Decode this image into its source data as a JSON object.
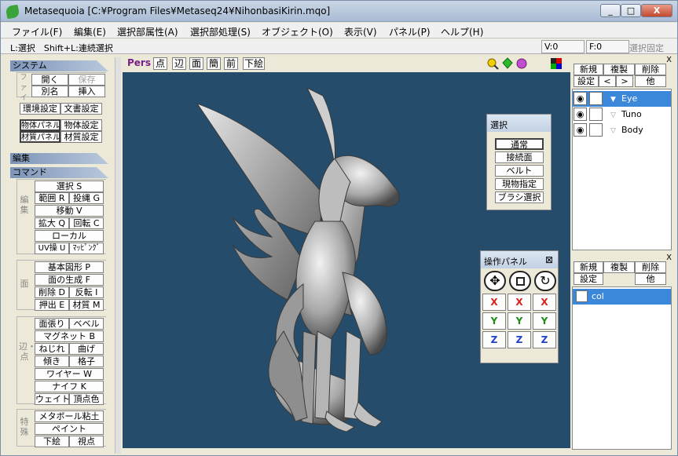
{
  "window": {
    "title": "Metasequoia [C:¥Program Files¥Metaseq24¥NihonbasiKirin.mqo]",
    "min": "_",
    "max": "□",
    "close": "X"
  },
  "menu": [
    "ファイル(F)",
    "編集(E)",
    "選択部属性(A)",
    "選択部処理(S)",
    "オブジェクト(O)",
    "表示(V)",
    "パネル(P)",
    "ヘルプ(H)"
  ],
  "status": {
    "hint": "L:選択　Shift+L:連続選択",
    "v": "V:0",
    "f": "F:0",
    "fix": "選択固定"
  },
  "left": {
    "system": "システム",
    "file_label": "ファイル",
    "open": "開く",
    "save": "保存",
    "rename": "別名",
    "insert": "挿入",
    "env": "環境設定",
    "doc": "文書設定",
    "obj_panel": "物体パネル",
    "obj_settings": "物体設定",
    "mat_panel": "材質パネル",
    "mat_settings": "材質設定",
    "edit": "編集",
    "command": "コマンド",
    "edit_label": "編集",
    "select": "選択 S",
    "range": "範囲 R",
    "throw": "投縄 G",
    "move": "移動 V",
    "scale": "拡大 Q",
    "rotate": "回転 C",
    "local": "ローカル",
    "uv": "UV操 U",
    "mapping": "ﾏｯﾋﾟﾝｸﾞ",
    "face_label": "面",
    "basic": "基本図形 P",
    "gen_face": "面の生成 F",
    "del": "削除 D",
    "flip": "反転 I",
    "extrude": "押出 E",
    "material": "材質 M",
    "edge_label": "辺・点",
    "stretch": "面張り",
    "bevel": "ベベル",
    "magnet": "マグネット B",
    "twist": "ねじれ",
    "bend": "曲げ",
    "tilt": "傾き",
    "lattice": "格子",
    "wire": "ワイヤー W",
    "knife": "ナイフ K",
    "weight": "ウェイト",
    "vcolor": "頂点色",
    "special_label": "特殊",
    "metaball": "メタボール粘土",
    "paint": "ペイント",
    "underlay": "下絵",
    "viewpoint": "視点"
  },
  "viewtools": {
    "pers": "Pers",
    "point": "点",
    "edge": "辺",
    "face": "面",
    "simple": "簡",
    "front": "前",
    "underlay": "下絵"
  },
  "select_panel": {
    "title": "選択",
    "normal": "通常",
    "contact": "接続面",
    "belt": "ベルト",
    "current": "現物指定",
    "brush": "ブラシ選択"
  },
  "op_panel": {
    "title": "操作パネル",
    "close": "⊠",
    "x": "X",
    "y": "Y",
    "z": "Z",
    "x_color": "#d42020",
    "y_color": "#1d8a1d",
    "z_color": "#2040c8"
  },
  "objects": {
    "new": "新規",
    "copy": "複製",
    "delete": "削除",
    "settings": "設定",
    "prev": "<",
    "next": ">",
    "other": "他",
    "items": [
      {
        "name": "Eye"
      },
      {
        "name": "Tuno"
      },
      {
        "name": "Body"
      }
    ],
    "eye_icon": "◉"
  },
  "materials": {
    "new": "新規",
    "copy": "複製",
    "delete": "削除",
    "settings": "設定",
    "other": "他",
    "items": [
      {
        "name": "col"
      }
    ]
  }
}
